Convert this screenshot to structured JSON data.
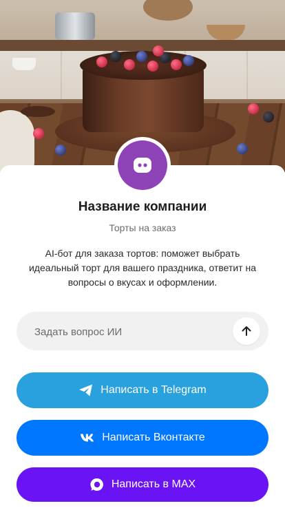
{
  "hero": {
    "alt_icon": "cake-photo"
  },
  "company": {
    "avatar_icon": "chat-bot-icon",
    "name": "Название компании",
    "tagline": "Торты на заказ",
    "description": "AI-бот для заказа тортов: поможет выбрать идеальный торт для вашего праздника, ответит на вопросы о вкусах и оформлении."
  },
  "ask": {
    "placeholder": "Задать вопрос ИИ",
    "send_icon": "arrow-up-icon"
  },
  "buttons": [
    {
      "label": "Написать в Telegram",
      "icon": "telegram-icon",
      "color": "#28a1de"
    },
    {
      "label": "Написать Вконтакте",
      "icon": "vk-icon",
      "color": "#0077ff"
    },
    {
      "label": "Написать в MAX",
      "icon": "max-icon",
      "color": "#6a14f5"
    }
  ],
  "colors": {
    "accent": "#8e44b8"
  }
}
